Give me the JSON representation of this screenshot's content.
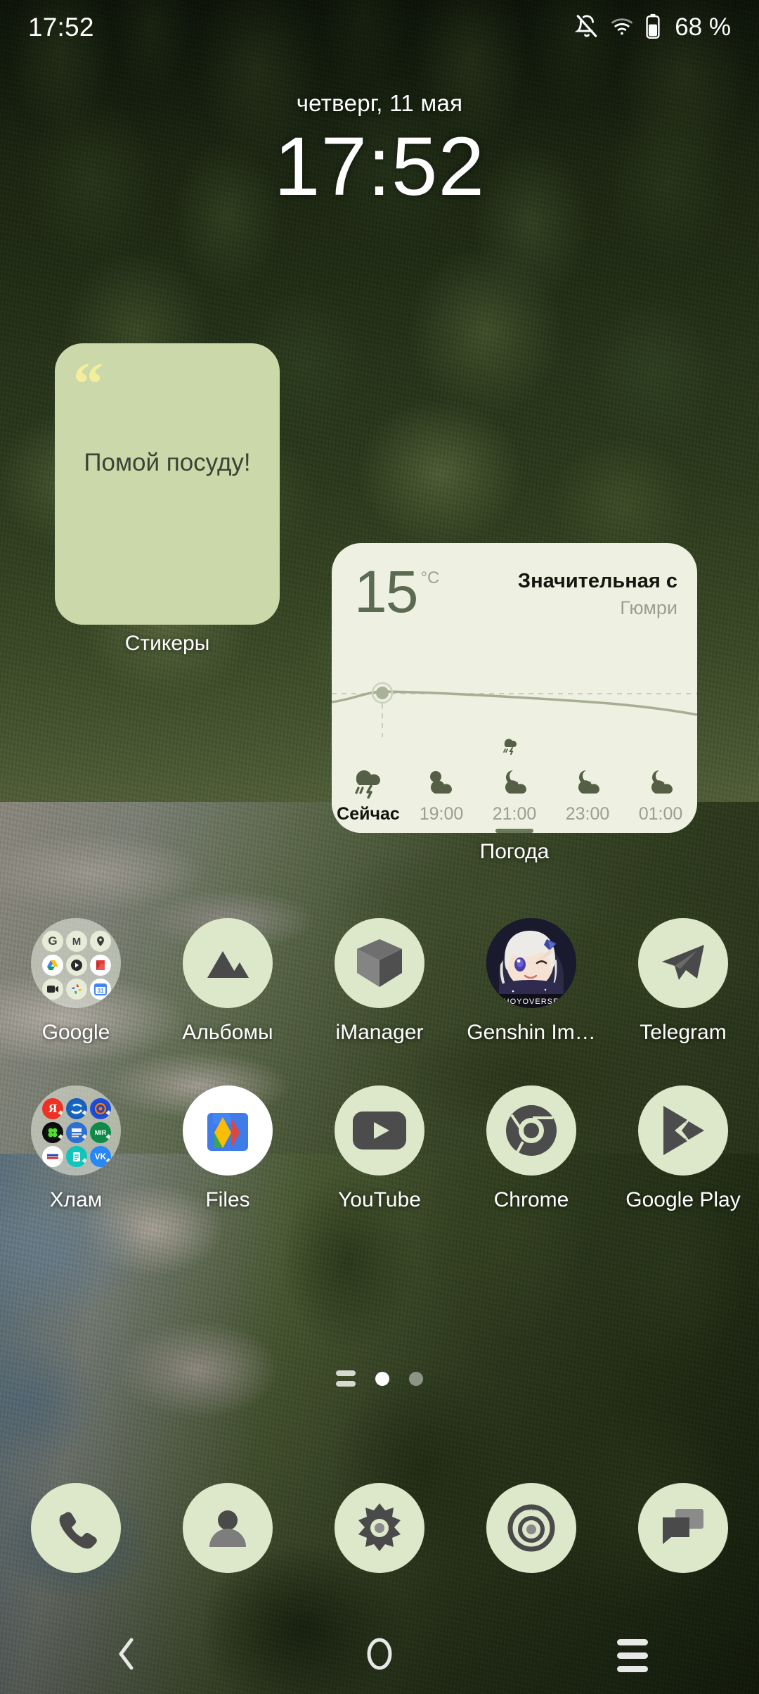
{
  "status_bar": {
    "time": "17:52",
    "battery_percent": "68 %",
    "icons": [
      "bell-off-icon",
      "wifi-icon",
      "battery-icon"
    ]
  },
  "clock_widget": {
    "date": "четверг, 11 мая",
    "time": "17:52"
  },
  "sticker_widget": {
    "quote_glyph": "“",
    "text": "Помой посуду!",
    "label": "Стикеры",
    "card_color": "#cbd9aa",
    "quote_color": "#f4ee9a"
  },
  "weather_widget": {
    "temperature": "15",
    "unit": "°C",
    "condition": "Значительная с",
    "city": "Гюмри",
    "label": "Погода",
    "card_color": "#eef0e2",
    "hours": [
      {
        "label": "Сейчас",
        "icon": "thunderstorm-rain-icon",
        "selected": false,
        "is_now": true
      },
      {
        "label": "19:00",
        "icon": "partly-cloudy-day-icon",
        "selected": false,
        "is_now": false
      },
      {
        "label": "21:00",
        "icon": "partly-cloudy-night-icon",
        "selected": true,
        "is_now": false
      },
      {
        "label": "23:00",
        "icon": "partly-cloudy-night-icon",
        "selected": false,
        "is_now": false
      },
      {
        "label": "01:00",
        "icon": "partly-cloudy-night-icon",
        "selected": false,
        "is_now": false
      }
    ]
  },
  "app_grid": {
    "row1": [
      {
        "label": "Google",
        "icon": "google-folder-icon",
        "type": "folder",
        "folder_items": [
          "google-search-icon",
          "gmail-icon",
          "maps-icon",
          "drive-icon",
          "podcasts-icon",
          "play-movies-icon",
          "meet-icon",
          "photos-icon",
          "calendar-icon"
        ]
      },
      {
        "label": "Альбомы",
        "icon": "albums-icon",
        "type": "app"
      },
      {
        "label": "iManager",
        "icon": "imanager-cube-icon",
        "type": "app"
      },
      {
        "label": "Genshin Im…",
        "icon": "genshin-impact-icon",
        "type": "app"
      },
      {
        "label": "Telegram",
        "icon": "telegram-icon",
        "type": "app"
      }
    ],
    "row2": [
      {
        "label": "Хлам",
        "icon": "junk-folder-icon",
        "type": "folder",
        "folder_items": [
          "yandex-icon",
          "sberbank-icon",
          "tinkoff-icon",
          "icq-icon",
          "news-icon",
          "mir-pay-icon",
          "gosuslugi-icon",
          "notes-icon",
          "vk-icon"
        ]
      },
      {
        "label": "Files",
        "icon": "files-icon",
        "type": "app"
      },
      {
        "label": "YouTube",
        "icon": "youtube-icon",
        "type": "app"
      },
      {
        "label": "Chrome",
        "icon": "chrome-icon",
        "type": "app"
      },
      {
        "label": "Google Play",
        "icon": "google-play-icon",
        "type": "app"
      }
    ]
  },
  "page_indicator": {
    "widget_page_icon": "widget-page-icon",
    "pages": 2,
    "active_index": 0
  },
  "dock": [
    {
      "label": "phone",
      "icon": "phone-icon"
    },
    {
      "label": "contacts",
      "icon": "contacts-icon"
    },
    {
      "label": "settings",
      "icon": "settings-gear-icon"
    },
    {
      "label": "camera",
      "icon": "camera-icon"
    },
    {
      "label": "messages",
      "icon": "messages-icon"
    }
  ],
  "nav_bar": [
    {
      "name": "back",
      "icon": "back-chevron-icon"
    },
    {
      "name": "home",
      "icon": "home-circle-icon"
    },
    {
      "name": "recents",
      "icon": "recents-lines-icon"
    }
  ]
}
